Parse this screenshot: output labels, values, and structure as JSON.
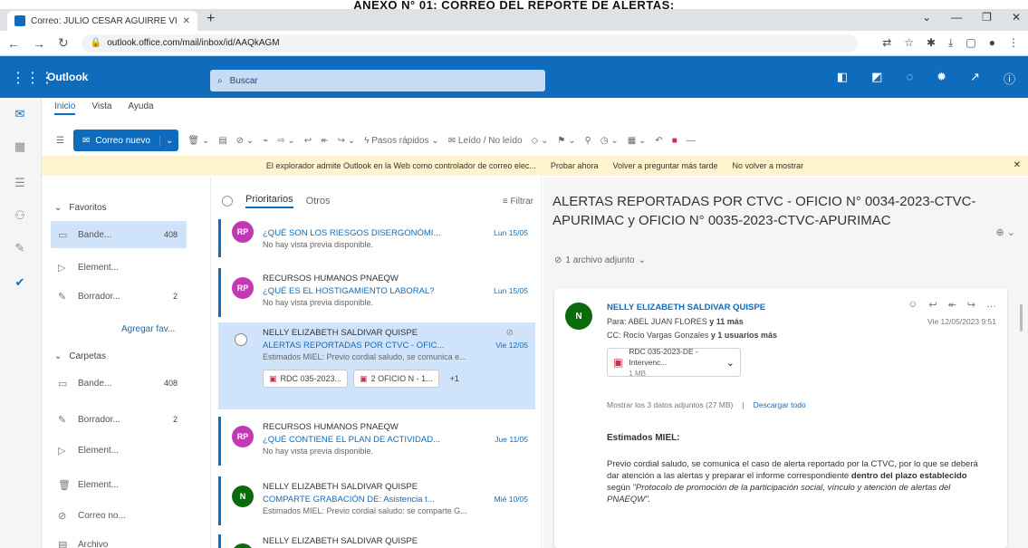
{
  "document_title": "ANEXO N° 01: CORREO DEL REPORTE DE ALERTAS:",
  "browser": {
    "tab_title": "Correo: JULIO CESAR AGUIRRE VI",
    "url": "outlook.office.com/mail/inbox/id/AAQkAGM",
    "colors": {
      "tabbar": "#dee1e6"
    }
  },
  "header": {
    "app_name": "Outlook",
    "search_placeholder": "Buscar",
    "color": "#0f6cbd"
  },
  "ribbon": {
    "tabs": [
      "Inicio",
      "Vista",
      "Ayuda"
    ],
    "new_mail": "Correo nuevo",
    "quick_steps": "Pasos rápidos",
    "read_unread": "Leído / No leído"
  },
  "banner": {
    "text": "El explorador admite Outlook en la Web como controlador de correo elec...",
    "try": "Probar ahora",
    "later": "Volver a preguntar más tarde",
    "never": "No volver a mostrar"
  },
  "folders": {
    "favorites_label": "Favoritos",
    "inbox": "Bande...",
    "inbox_count": "408",
    "deleted": "Element...",
    "drafts": "Borrador...",
    "drafts_count": "2",
    "add_favorite": "Agregar fav...",
    "folders_label": "Carpetas",
    "inbox2": "Bande...",
    "inbox2_count": "408",
    "drafts2": "Borrador...",
    "drafts2_count": "2",
    "deleted2": "Element...",
    "sent": "Element...",
    "junk": "Correo no...",
    "archive": "Archivo"
  },
  "list": {
    "tab_priority": "Prioritarios",
    "tab_other": "Otros",
    "filter": "Filtrar",
    "messages": [
      {
        "initials": "RP",
        "color": "#c239b3",
        "sender": "",
        "subject": "¿QUÉ SON LOS RIESGOS DISERGONÓMI...",
        "date": "Lun 15/05",
        "preview": "No hay vista previa disponible."
      },
      {
        "initials": "RP",
        "color": "#c239b3",
        "sender": "RECURSOS HUMANOS PNAEQW",
        "subject": "¿QUÉ ES EL HOSTIGAMIENTO LABORAL?",
        "date": "Lun 15/05",
        "preview": "No hay vista previa disponible."
      },
      {
        "initials": "",
        "color": "#ffffff",
        "sender": "NELLY ELIZABETH SALDIVAR QUISPE",
        "subject": "ALERTAS REPORTADAS POR CTVC - OFIC...",
        "date": "Vie 12/05",
        "preview": "Estimados MIEL: Previo cordial saludo, se comunica e...",
        "attach1": "RDC 035-2023...",
        "attach2": "2 OFICIO N - 1...",
        "attach_more": "+1"
      },
      {
        "initials": "RP",
        "color": "#c239b3",
        "sender": "RECURSOS HUMANOS PNAEQW",
        "subject": "¿QUÉ CONTIENE EL PLAN DE ACTIVIDAD...",
        "date": "Jue 11/05",
        "preview": "No hay vista previa disponible."
      },
      {
        "initials": "N",
        "color": "#0b6a0b",
        "sender": "NELLY ELIZABETH SALDIVAR QUISPE",
        "subject": "COMPARTE GRABACIÓN DE: Asistencia t...",
        "date": "Mié 10/05",
        "preview": "Estimados MIEL: Previo cordial saludo: se comparte G..."
      },
      {
        "initials": "N",
        "color": "#0b6a0b",
        "sender": "NELLY ELIZABETH SALDIVAR QUISPE",
        "subject": "",
        "date": "",
        "preview": ""
      }
    ]
  },
  "reading": {
    "title": "ALERTAS REPORTADAS POR CTVC - OFICIO N° 0034-2023-CTVC-APURIMAC y OFICIO N° 0035-2023-CTVC-APURIMAC",
    "attachments_count": "1 archivo adjunto",
    "avatar": "N",
    "from": "NELLY ELIZABETH SALDIVAR QUISPE",
    "to_prefix": "Para:",
    "to_name": "ABEL JUAN FLORES",
    "to_more": "y 11 más",
    "cc_prefix": "CC:",
    "cc_name": "Rocío Vargas Gonzales",
    "cc_more": "y 1 usuarios más",
    "date": "Vie 12/05/2023 9:51",
    "file_name": "RDC 035-2023-DE - Intervenc...",
    "file_size": "1 MB",
    "download_info": "Mostrar los 3 datos adjuntos (27 MB)",
    "download_link": "Descargar todo",
    "greeting": "Estimados MIEL:",
    "body_1": "Previo cordial saludo, se comunica el caso de alerta reportado por la CTVC, por lo que se deberá dar atención a las alertas y preparar el informe correspondiente",
    "body_bold": "dentro del plazo establecido",
    "body_2": "según",
    "body_italic": "\"Protocolo de promoción de la participación social, vínculo y atención de alertas del PNAEQW\"."
  }
}
